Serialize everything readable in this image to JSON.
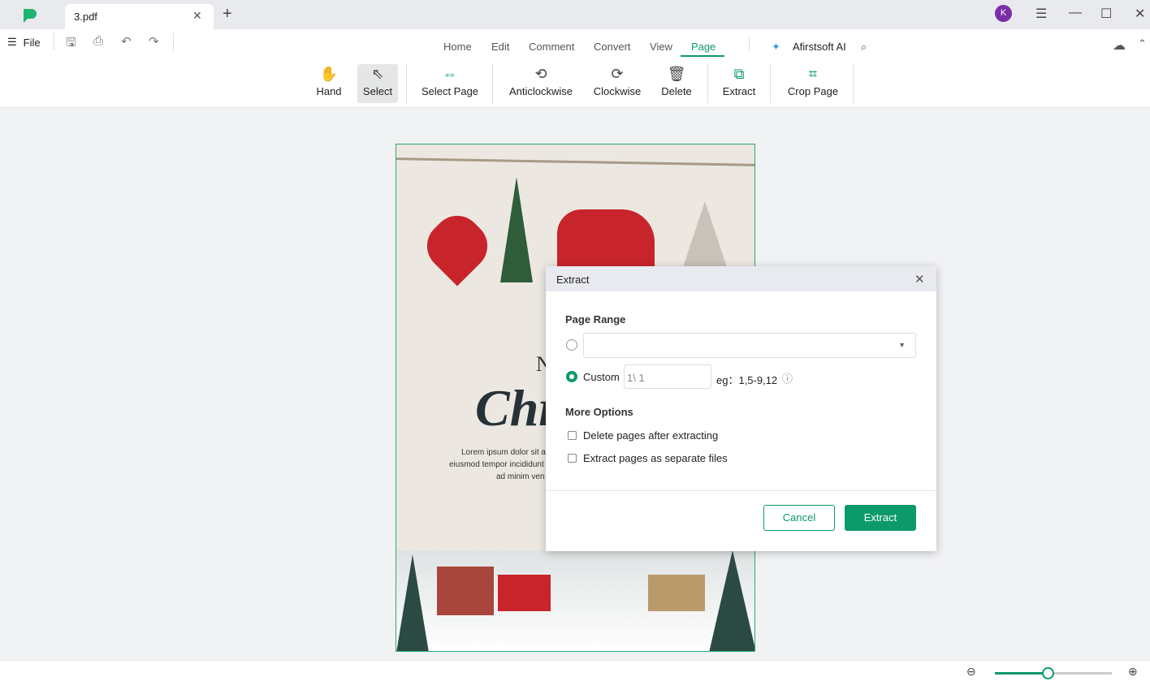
{
  "tab": {
    "title": "3.pdf"
  },
  "user": {
    "initial": "K"
  },
  "file_label": "File",
  "menu": [
    "Home",
    "Edit",
    "Comment",
    "Convert",
    "View",
    "Page"
  ],
  "ai_label": "Afirstsoft AI",
  "tools": [
    "Hand",
    "Select",
    "Select Page",
    "Anticlockwise",
    "Clockwise",
    "Delete",
    "Extract",
    "Crop Page"
  ],
  "pdf": {
    "title_partial": "Chr",
    "letter": "N",
    "lines": [
      "Lorem ipsum dolor sit a",
      "eiusmod tempor incididunt",
      "ad minim ven"
    ]
  },
  "dialog": {
    "title": "Extract",
    "page_range": "Page Range",
    "custom": "Custom",
    "custom_value": "1\\ 1",
    "example": "eg：1,5-9,12",
    "more_options": "More Options",
    "opt1": "Delete pages after extracting",
    "opt2": "Extract pages as separate files",
    "cancel": "Cancel",
    "extract": "Extract"
  },
  "colors": {
    "accent": "#0d9a6a",
    "avatar": "#7b2ea8"
  },
  "zoom_slider": 0.45
}
